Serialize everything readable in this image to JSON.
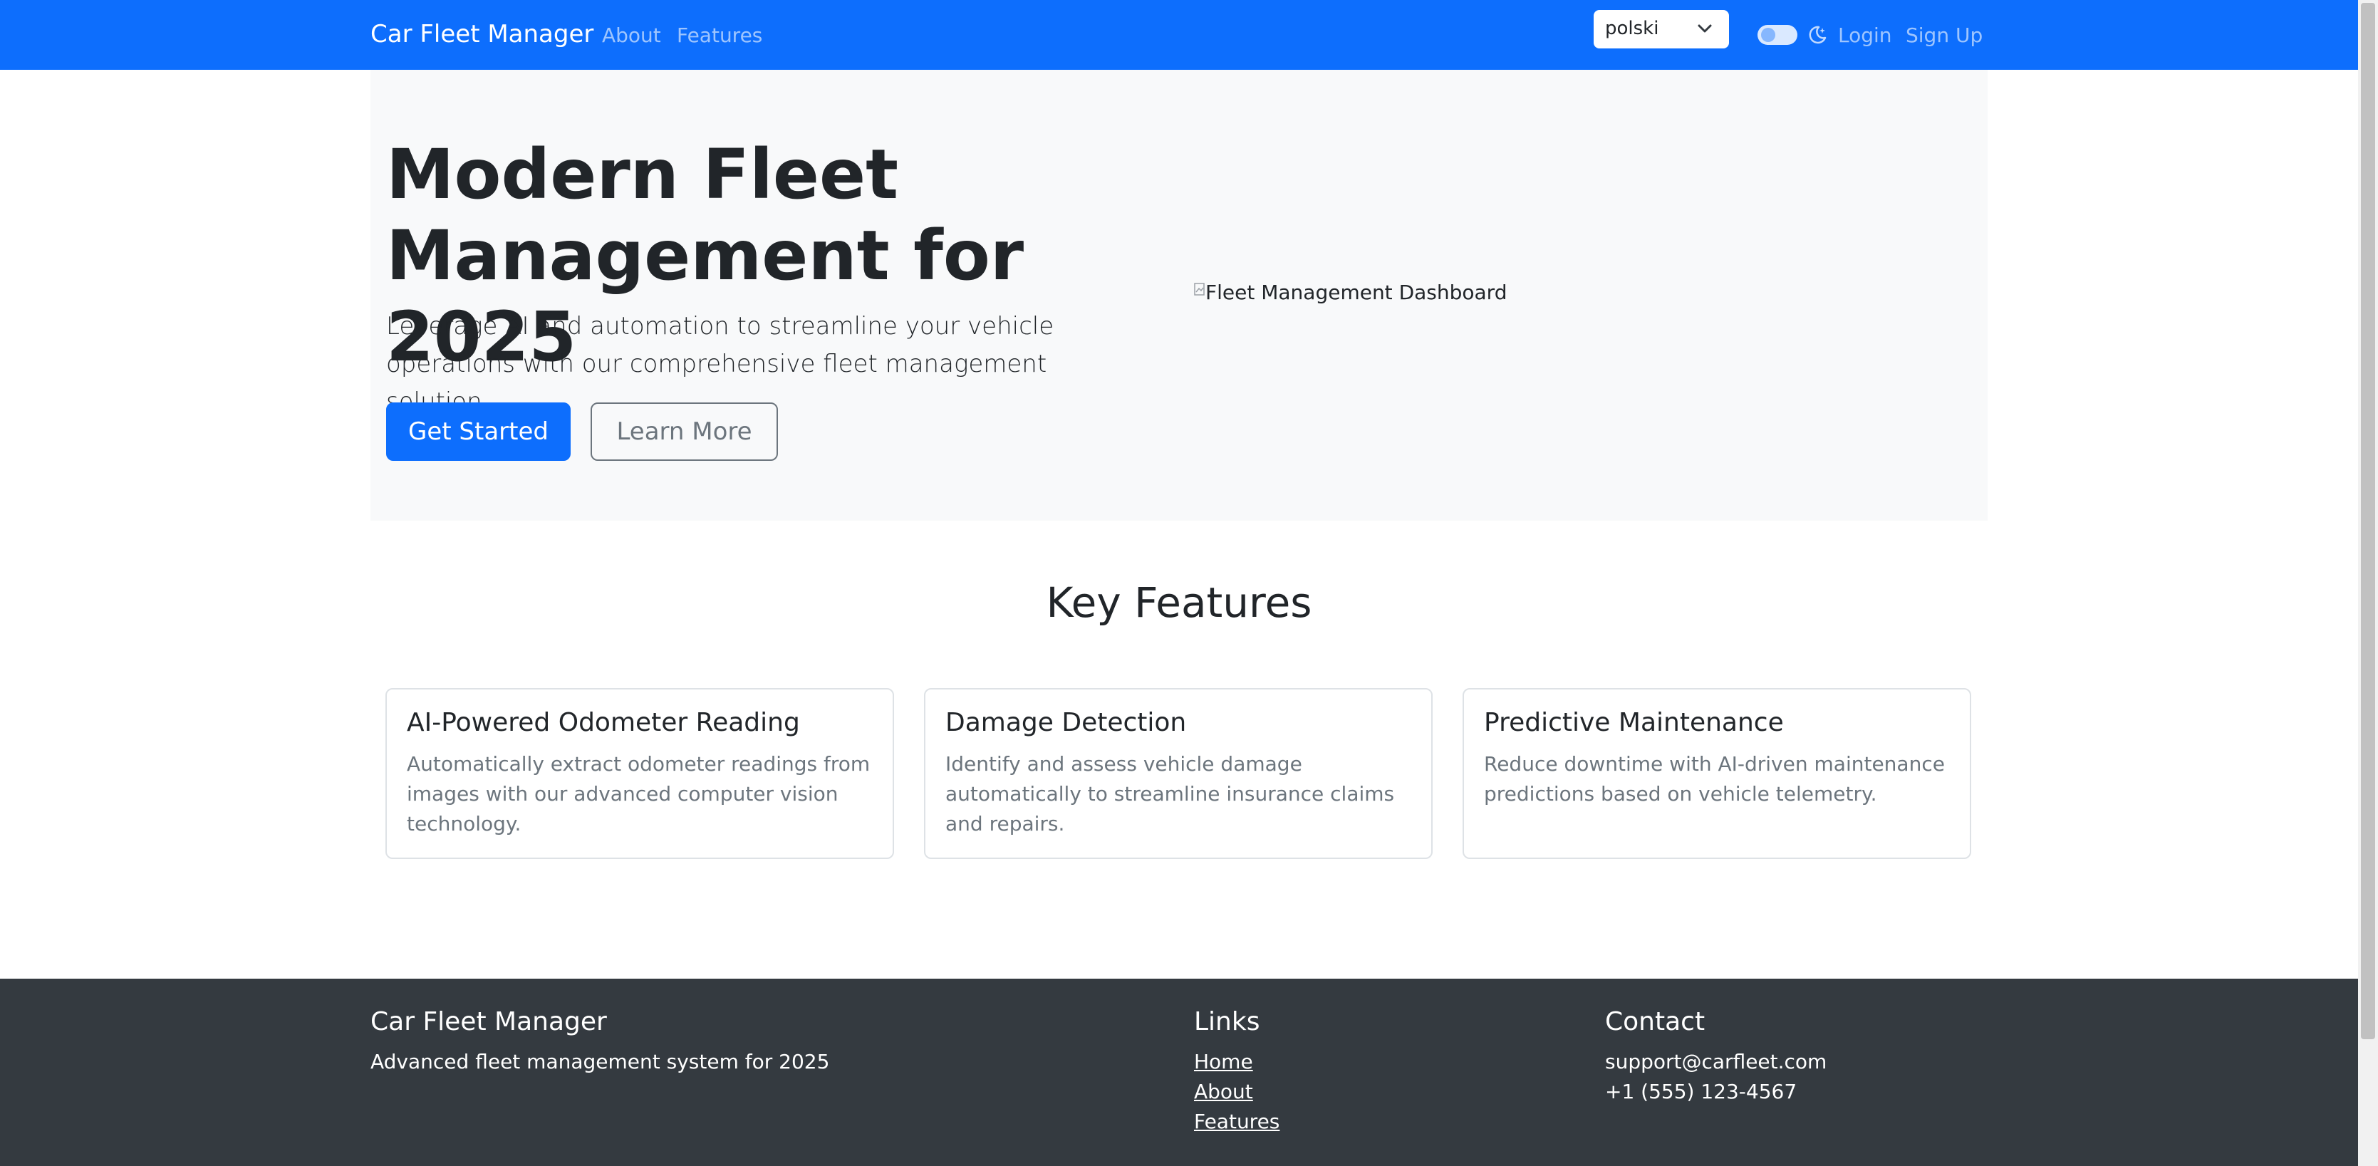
{
  "navbar": {
    "brand": "Car Fleet Manager",
    "links": [
      "About",
      "Features"
    ],
    "language": "polski",
    "auth": {
      "login": "Login",
      "signup": "Sign Up"
    }
  },
  "hero": {
    "title": "Modern Fleet Management for 2025",
    "lead": "Leverage AI and automation to streamline your vehicle operations with our comprehensive fleet management solution.",
    "primary_button": "Get Started",
    "secondary_button": "Learn More",
    "image_alt": "Fleet Management Dashboard"
  },
  "features": {
    "title": "Key Features",
    "cards": [
      {
        "title": "AI-Powered Odometer Reading",
        "text": "Automatically extract odometer readings from images with our advanced computer vision technology."
      },
      {
        "title": "Damage Detection",
        "text": "Identify and assess vehicle damage automatically to streamline insurance claims and repairs."
      },
      {
        "title": "Predictive Maintenance",
        "text": "Reduce downtime with AI-driven maintenance predictions based on vehicle telemetry."
      }
    ]
  },
  "footer": {
    "brand": "Car Fleet Manager",
    "tagline": "Advanced fleet management system for 2025",
    "links_title": "Links",
    "links": [
      "Home",
      "About",
      "Features"
    ],
    "contact_title": "Contact",
    "email": "support@carfleet.com",
    "phone": "+1 (555) 123-4567"
  },
  "colors": {
    "primary": "#0d6efd",
    "footer_bg": "#343a40",
    "hero_bg": "#f8f9fa"
  },
  "icons": [
    "chevron-down-icon",
    "moon-icon",
    "broken-image-icon"
  ]
}
